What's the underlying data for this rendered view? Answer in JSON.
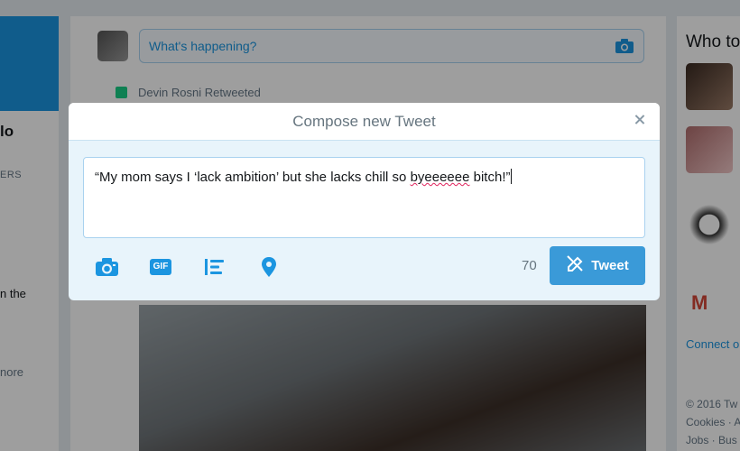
{
  "background": {
    "left": {
      "name_fragment": "lo",
      "stat_label": "ERS",
      "text_a": "n the",
      "text_b": "nore"
    },
    "compose": {
      "placeholder": "What's happening?"
    },
    "timeline": {
      "retweet_text": "Devin Rosni Retweeted"
    },
    "right": {
      "who_to_follow": "Who to",
      "connect_link": "Connect o",
      "footer_a": "© 2016 Tw",
      "footer_b": "Cookies · A",
      "footer_c": "Jobs · Bus"
    }
  },
  "modal": {
    "title": "Compose new Tweet",
    "tweet_text_before": "“My mom says I ‘lack ambition’ but she lacks chill so ",
    "tweet_text_misspelled": "byeeeeee",
    "tweet_text_after": " bitch!”",
    "char_count": "70",
    "tweet_button_label": "Tweet",
    "gif_label": "GIF"
  },
  "colors": {
    "accent": "#1b95e0",
    "tweet_button": "#3a9ad8",
    "modal_bg": "#e8f4fb"
  },
  "icons": [
    "camera-icon",
    "gif-icon",
    "poll-icon",
    "location-pin-icon",
    "close-icon",
    "compose-quill-icon"
  ]
}
